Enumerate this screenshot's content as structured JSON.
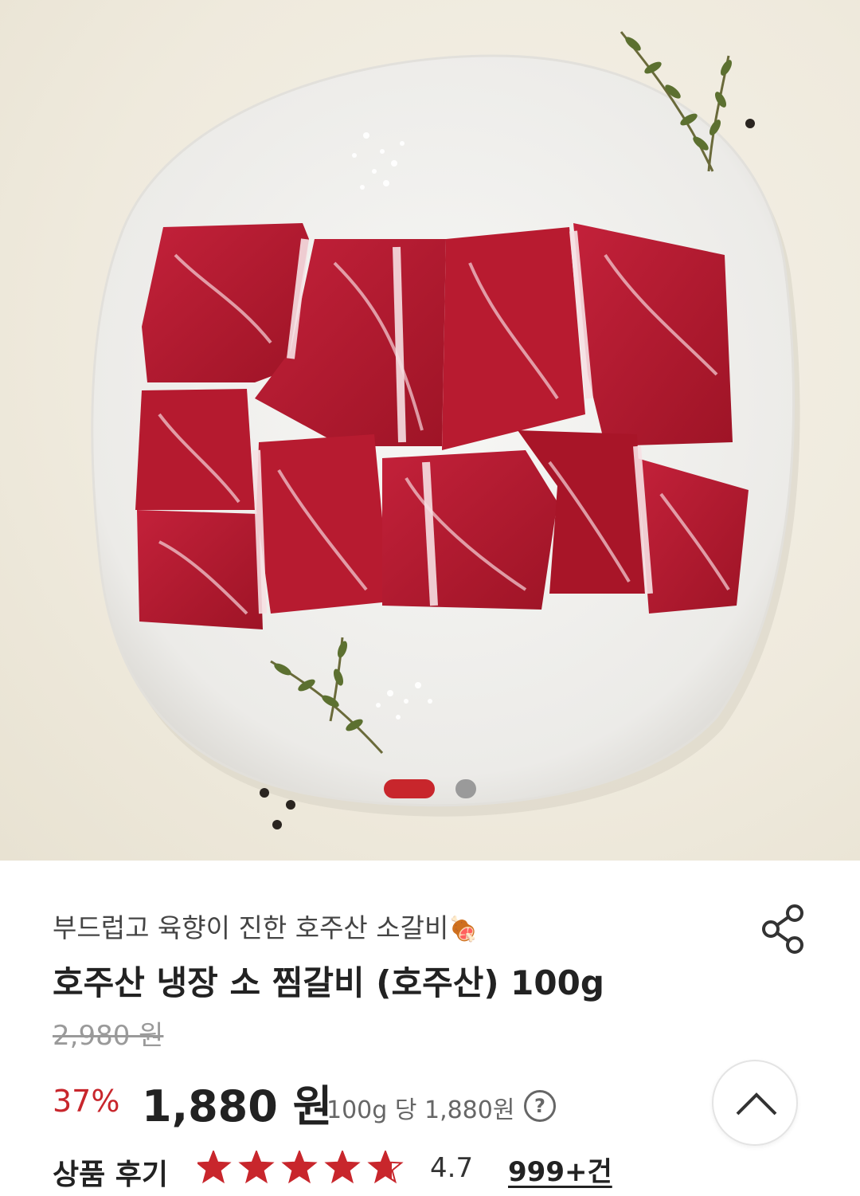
{
  "carousel": {
    "image_alt_name": "raw beef ribs on white plate with thyme",
    "active_index": 0,
    "total": 2
  },
  "product": {
    "subtitle": "부드럽고 육향이 진한 호주산 소갈비",
    "subtitle_emoji": "🍖",
    "title": "호주산 냉장 소 찜갈비 (호주산) 100g",
    "original_price": "2,980 원",
    "discount": "37%",
    "price": "1,880 원",
    "unit_price": "100g 당 1,880원",
    "help_symbol": "?"
  },
  "reviews": {
    "label": "상품 후기",
    "rating_value": 4.7,
    "rating_text": "4.7",
    "count": "999+건"
  },
  "icons": {
    "share": "share-icon",
    "scroll_top": "chevron-up-icon",
    "help": "question-circle-icon",
    "star": "star-icon"
  },
  "colors": {
    "accent": "#c8262c",
    "dot_inactive": "#9a9a9a",
    "star": "#c8262c"
  }
}
